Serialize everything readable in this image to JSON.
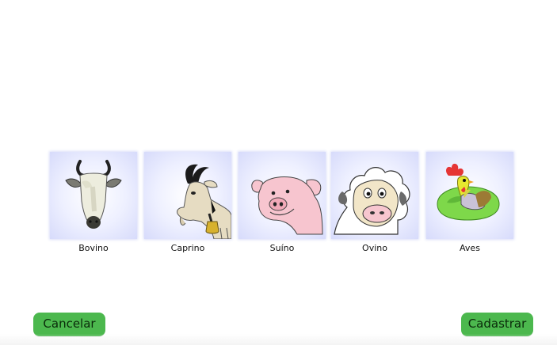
{
  "animals": [
    {
      "label": "Bovino",
      "icon": "cow-icon"
    },
    {
      "label": "Caprino",
      "icon": "goat-icon"
    },
    {
      "label": "Suíno",
      "icon": "pig-icon"
    },
    {
      "label": "Ovino",
      "icon": "sheep-icon"
    },
    {
      "label": "Aves",
      "icon": "rooster-icon"
    }
  ],
  "actions": {
    "cancel_label": "Cancelar",
    "save_label": "Cadastrar"
  },
  "colors": {
    "button": "#4cb84e",
    "tile_tint": "#d7dbfb"
  }
}
